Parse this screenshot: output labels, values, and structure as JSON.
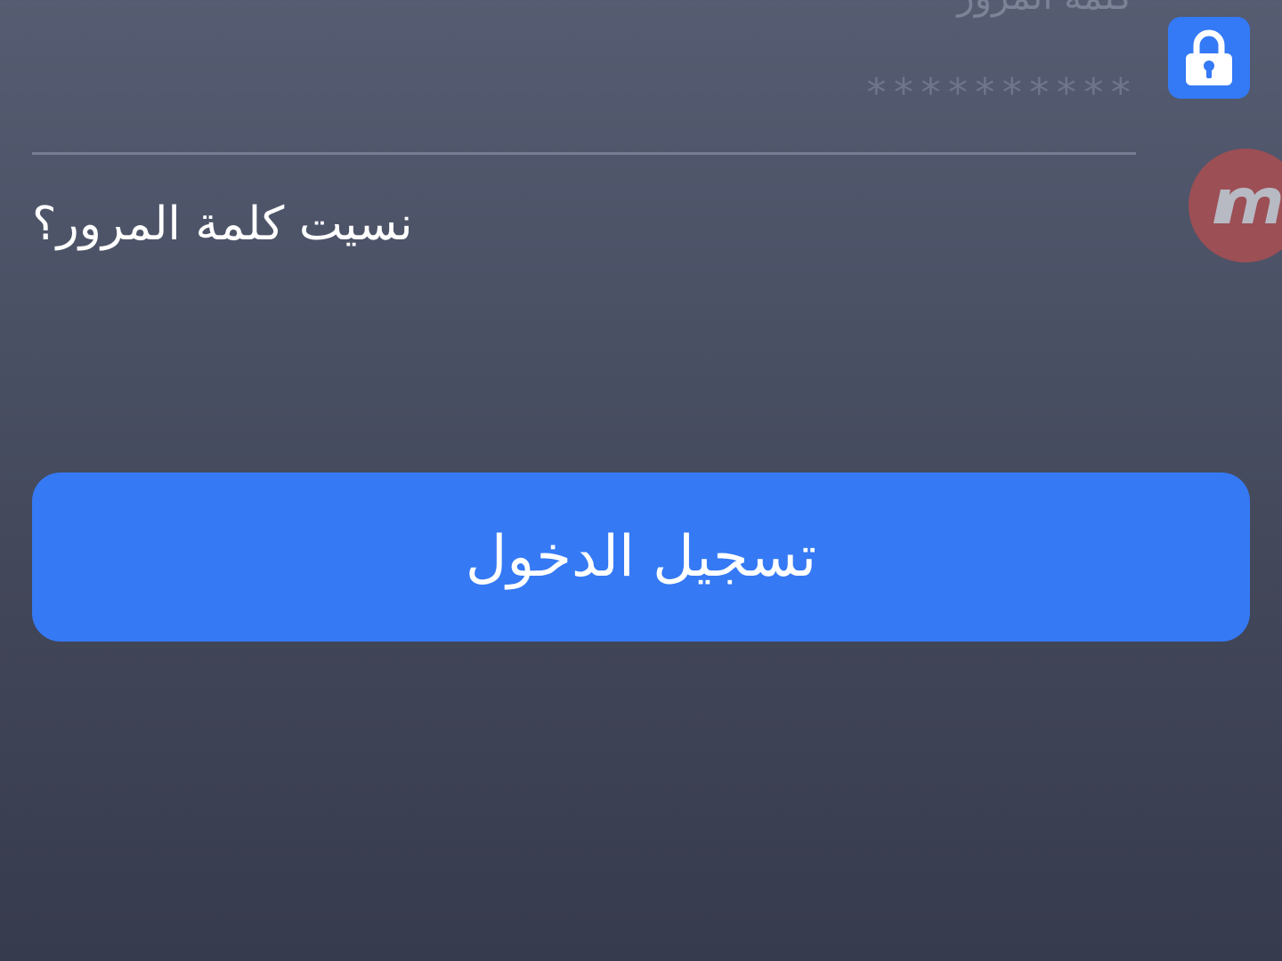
{
  "password_field": {
    "label": "كلمة المرور",
    "placeholder": "**********",
    "lock_icon": "lock-icon",
    "accent_color": "#3479f5"
  },
  "forgot_password": {
    "label": "نسيت كلمة المرور؟"
  },
  "login_button": {
    "label": "تسجيل الدخول",
    "color": "#3579f4"
  },
  "floating_button": {
    "icon": "m-logo-icon",
    "color": "#9c4f55"
  }
}
